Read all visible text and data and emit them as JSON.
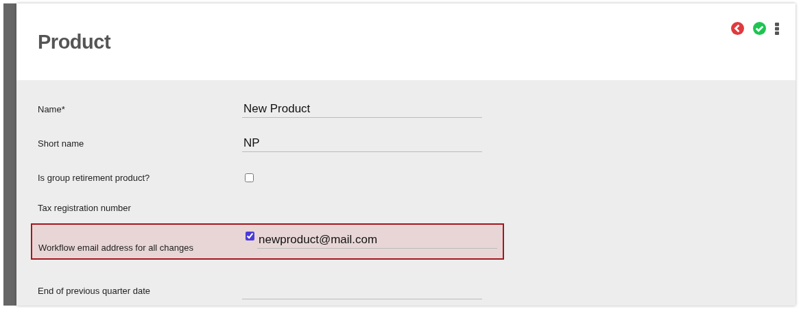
{
  "header": {
    "title": "Product"
  },
  "fields": [
    {
      "kind": "text",
      "label": "Name*",
      "value": "New Product",
      "highlighted": false
    },
    {
      "kind": "text",
      "label": "Short name",
      "value": "NP",
      "highlighted": false
    },
    {
      "kind": "checkbox",
      "label": "Is group retirement product?",
      "checked": false,
      "highlighted": false
    },
    {
      "kind": "label",
      "label": "Tax registration number",
      "highlighted": false
    },
    {
      "kind": "checkbox-text",
      "label": "Workflow email address for all changes",
      "checked": true,
      "value": "newproduct@mail.com",
      "highlighted": true
    },
    {
      "kind": "text",
      "label": "End of previous quarter date",
      "highlighted": false
    }
  ]
}
